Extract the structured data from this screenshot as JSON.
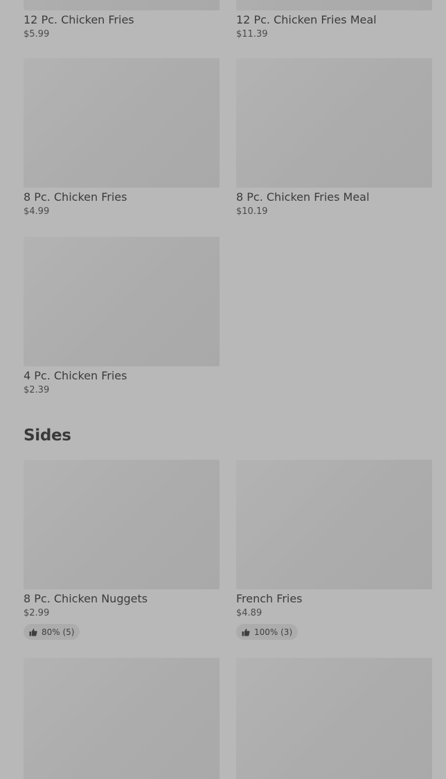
{
  "items_top": [
    {
      "name": "12 Pc. Chicken Fries",
      "price": "$5.99"
    },
    {
      "name": "12 Pc. Chicken Fries Meal",
      "price": "$11.39"
    },
    {
      "name": "8 Pc. Chicken Fries",
      "price": "$4.99"
    },
    {
      "name": "8 Pc. Chicken Fries Meal",
      "price": "$10.19"
    },
    {
      "name": "4 Pc. Chicken Fries",
      "price": "$2.39"
    }
  ],
  "sides": {
    "title": "Sides",
    "items": [
      {
        "name": "8 Pc. Chicken Nuggets",
        "price": "$2.99",
        "rating": "80% (5)"
      },
      {
        "name": "French Fries",
        "price": "$4.89",
        "rating": "100% (3)"
      }
    ]
  },
  "icons": {
    "rating": "thumbs-up-icon"
  },
  "colors": {
    "background": "#b8b8b8",
    "image_placeholder": "#acacac",
    "text": "#3b3b3b"
  }
}
